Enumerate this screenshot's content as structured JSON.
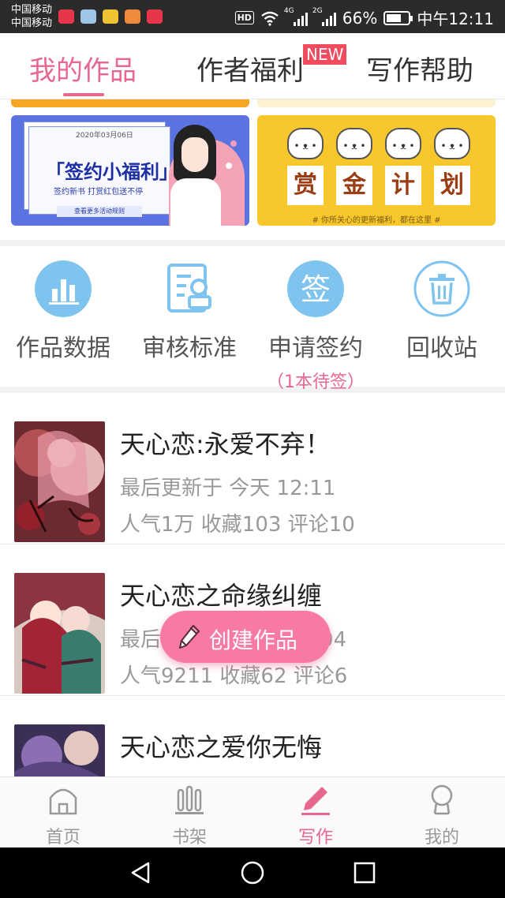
{
  "status_bar": {
    "carrier_1": "中国移动",
    "carrier_2": "中国移动",
    "hd": "HD",
    "net_1": "4G",
    "net_2": "2G",
    "battery": "66%",
    "time": "中午12:11",
    "battery_level": 0.66
  },
  "tabs": [
    {
      "label": "我的作品"
    },
    {
      "label": "作者福利"
    },
    {
      "label": "写作帮助"
    }
  ],
  "new_badge": "NEW",
  "banners": {
    "left": {
      "date": "2020年03月06日",
      "title": "「签约小福利」",
      "subtitle": "签约新书  打赏红包送不停",
      "link": "查看更多活动规则"
    },
    "right": {
      "chars": [
        "赏",
        "金",
        "计",
        "划"
      ],
      "caption": "# 你所关心的更新福利，都在这里 #"
    }
  },
  "quick_actions": [
    {
      "label": "作品数据",
      "icon": "bar-chart-icon"
    },
    {
      "label": "审核标准",
      "icon": "review-doc-icon"
    },
    {
      "label": "申请签约",
      "icon": "sign-icon",
      "glyph": "签",
      "sub": "（1本待签）"
    },
    {
      "label": "回收站",
      "icon": "trash-icon"
    }
  ],
  "works": [
    {
      "title": "天心恋:永爱不弃！",
      "updated": "最后更新于 今天 12:11",
      "stats": "人气1万 收藏103 评论10"
    },
    {
      "title": "天心恋之命缘纠缠",
      "updated": "最后更新于 2020.03.04",
      "stats": "人气9211 收藏62 评论6"
    },
    {
      "title": "天心恋之爱你无悔",
      "updated": "",
      "stats": ""
    }
  ],
  "fab": {
    "label": "创建作品",
    "icon": "pencil-icon"
  },
  "bottom_nav": [
    {
      "label": "首页",
      "icon": "home-icon"
    },
    {
      "label": "书架",
      "icon": "bookshelf-icon"
    },
    {
      "label": "写作",
      "icon": "write-pen-icon"
    },
    {
      "label": "我的",
      "icon": "profile-icon"
    }
  ],
  "colors": {
    "accent": "#e8678e",
    "fab": "#f77aa6",
    "badge": "#f14b5e",
    "icon_blue": "#7fc3ef"
  }
}
